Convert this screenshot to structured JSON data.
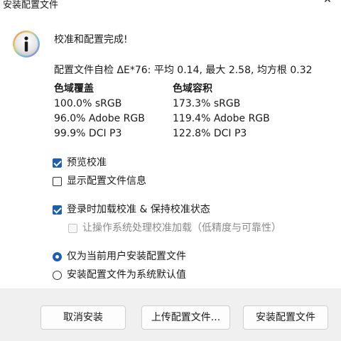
{
  "window": {
    "title": "安装配置文件"
  },
  "message": {
    "heading": "校准和配置完成!",
    "selfcheck": "配置文件自检 ΔE*76: 平均 0.14, 最大 2.58, 均方根 0.32"
  },
  "gamut": {
    "coverage_label": "色域覆盖",
    "coverage": [
      "100.0% sRGB",
      "96.0% Adobe RGB",
      "99.9% DCI P3"
    ],
    "volume_label": "色域容积",
    "volume": [
      "173.3% sRGB",
      "119.4% Adobe RGB",
      "122.8% DCI P3"
    ]
  },
  "options": {
    "preview": {
      "label": "预览校准",
      "checked": true
    },
    "show_info": {
      "label": "显示配置文件信息",
      "checked": false
    },
    "load_on_login": {
      "label": "登录时加载校准 & 保持校准状态",
      "checked": true
    },
    "os_handle": {
      "label": "让操作系统处理校准加载（低精度与可靠性）",
      "checked": false,
      "disabled": true
    }
  },
  "install_scope": {
    "current_user": {
      "label": "仅为当前用户安装配置文件",
      "selected": true
    },
    "system_default": {
      "label": "安装配置文件为系统默认值",
      "selected": false
    }
  },
  "buttons": {
    "cancel": "取消安装",
    "upload": "上传配置文件...",
    "install": "安装配置文件"
  },
  "colors": {
    "accent": "#1a5fb4",
    "icon_ring": "#7fb4e0"
  }
}
